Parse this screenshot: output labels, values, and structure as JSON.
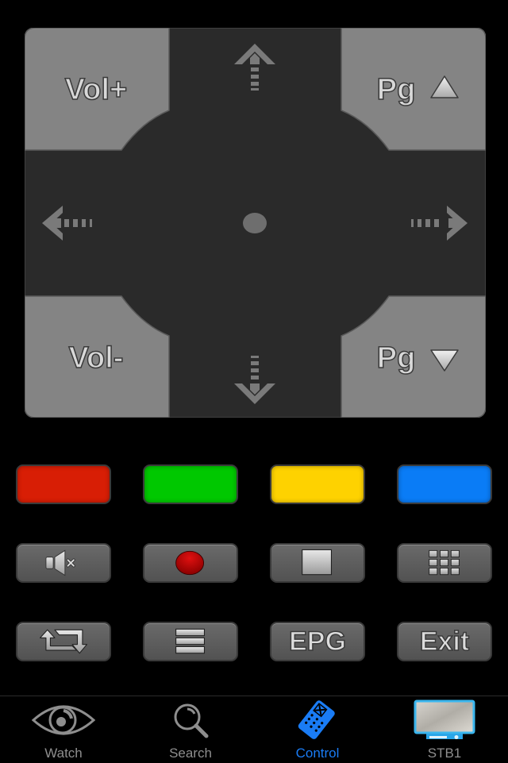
{
  "dpad": {
    "vol_up_label": "Vol+",
    "vol_down_label": "Vol-",
    "page_up_label": "Pg",
    "page_down_label": "Pg",
    "icons": [
      "arrow-up-icon",
      "arrow-down-icon",
      "arrow-left-icon",
      "arrow-right-icon",
      "ok-dot-icon",
      "triangle-up-icon",
      "triangle-down-icon"
    ]
  },
  "color_buttons": [
    {
      "name": "red",
      "color": "#d81e05"
    },
    {
      "name": "green",
      "color": "#00c800"
    },
    {
      "name": "yellow",
      "color": "#fed200"
    },
    {
      "name": "blue",
      "color": "#0a7cf6"
    }
  ],
  "control_buttons": [
    {
      "name": "mute",
      "icon": "mute-icon"
    },
    {
      "name": "record",
      "icon": "record-icon"
    },
    {
      "name": "stop",
      "icon": "stop-icon"
    },
    {
      "name": "keypad",
      "icon": "keypad-icon"
    }
  ],
  "function_buttons": [
    {
      "name": "swap",
      "icon": "swap-arrows-icon",
      "label": ""
    },
    {
      "name": "menu",
      "icon": "menu-icon",
      "label": ""
    },
    {
      "name": "epg",
      "label": "EPG"
    },
    {
      "name": "exit",
      "label": "Exit"
    }
  ],
  "tabbar": {
    "active_color": "#1a7cf5",
    "tabs": [
      {
        "label": "Watch",
        "icon": "eye-icon",
        "active": false
      },
      {
        "label": "Search",
        "icon": "magnifier-icon",
        "active": false
      },
      {
        "label": "Control",
        "icon": "remote-icon",
        "active": true
      },
      {
        "label": "STB1",
        "icon": "tv-stb-icon",
        "active": false
      }
    ]
  }
}
